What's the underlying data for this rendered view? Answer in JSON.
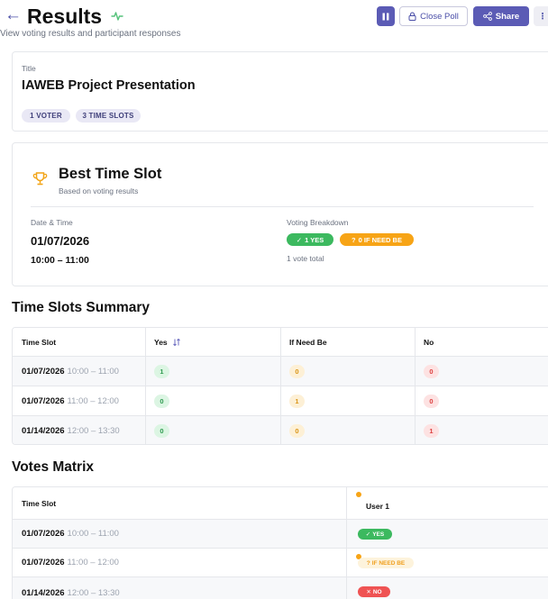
{
  "header": {
    "title": "Results",
    "subtitle": "View voting results and participant responses",
    "close_poll_label": "Close Poll",
    "share_label": "Share",
    "more_label": "⋮"
  },
  "poll": {
    "title_label": "Title",
    "title": "IAWEB Project Presentation",
    "voters_chip": "1 VOTER",
    "slots_chip": "3 TIME SLOTS"
  },
  "best": {
    "title": "Best Time Slot",
    "subtitle": "Based on voting results",
    "date_time_label": "Date & Time",
    "date": "01/07/2026",
    "time": "10:00 – 11:00",
    "breakdown_label": "Voting Breakdown",
    "yes_pill": "1 YES",
    "maybe_pill": "0 IF NEED BE",
    "vote_total": "1 vote total"
  },
  "summary": {
    "title": "Time Slots Summary",
    "headers": [
      "Time Slot",
      "Yes",
      "If Need Be",
      "No"
    ],
    "rows": [
      {
        "date": "01/07/2026",
        "time": "10:00 – 11:00",
        "yes": "1",
        "maybe": "0",
        "no": "0"
      },
      {
        "date": "01/07/2026",
        "time": "11:00 – 12:00",
        "yes": "0",
        "maybe": "1",
        "no": "0"
      },
      {
        "date": "01/14/2026",
        "time": "12:00 – 13:30",
        "yes": "0",
        "maybe": "0",
        "no": "1"
      }
    ]
  },
  "matrix": {
    "title": "Votes Matrix",
    "headers": [
      "Time Slot",
      "User 1"
    ],
    "rows": [
      {
        "date": "01/07/2026",
        "time": "10:00 – 11:00",
        "vote": "YES",
        "vote_icon": "✓"
      },
      {
        "date": "01/07/2026",
        "time": "11:00 – 12:00",
        "vote": "IF NEED BE",
        "vote_icon": "?"
      },
      {
        "date": "01/14/2026",
        "time": "12:00 – 13:30",
        "vote": "NO",
        "vote_icon": "✕"
      }
    ]
  },
  "icons": {
    "back": "←",
    "check": "✓",
    "question": "?"
  },
  "colors": {
    "accent": "#5b5bb5",
    "yes": "#3cb95f",
    "maybe": "#f7a416",
    "no": "#ef5353"
  }
}
